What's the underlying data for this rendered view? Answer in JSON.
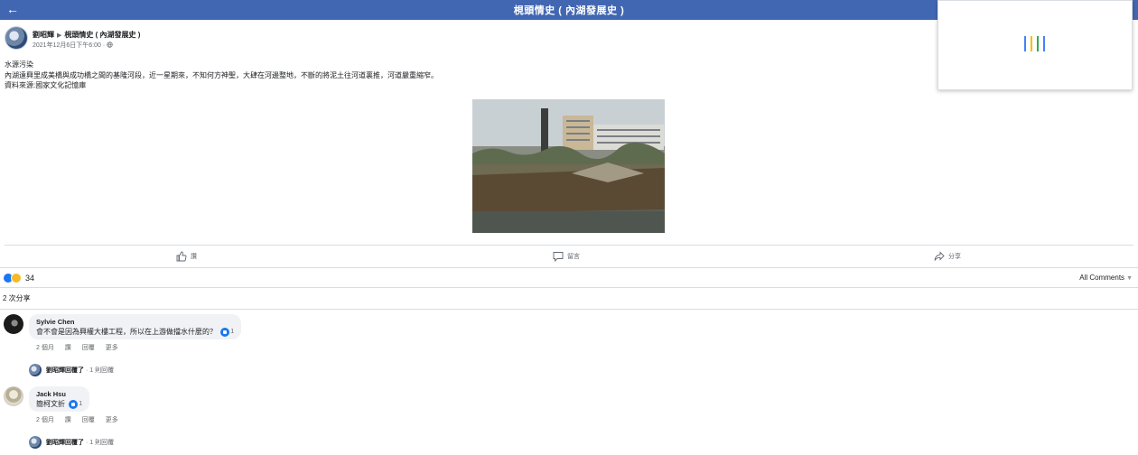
{
  "header": {
    "back_icon": "back-arrow-icon",
    "title": "梘頭情史 ( 內湖發展史 )"
  },
  "popup": {
    "spinner_colors": [
      "#4285f4",
      "#ea4335",
      "#fbbc05",
      "#34a853"
    ]
  },
  "post": {
    "author": "劉昭輝",
    "arrow": "▶",
    "group": "梘頭情史 ( 內湖發展史 )",
    "timestamp": "2021年12月6日下午6:00",
    "privacy_icon": "globe-icon",
    "text_lines": [
      "水源污染",
      "內湖遠興里成美橋與成功橋之間的基隆河段，近一星期來，不知何方神聖，大肆在河邊整地，不斷的將泥土往河道裏推，河道嚴重縮窄。",
      "資料來源:國家文化記憶庫"
    ]
  },
  "actions": {
    "like": "讚",
    "comment": "留言",
    "share": "分享"
  },
  "reactions": {
    "count": "34",
    "all_comments": "All Comments",
    "shares_text": "2 次分享"
  },
  "comments": [
    {
      "name": "Sylvie Chen",
      "text": "會不會是因為興權大樓工程，所以在上游做擋水什麼的？",
      "like_count": "1",
      "time": "2 個月",
      "like": "讚",
      "reply": "回覆",
      "more": "更多",
      "reply_summary_name": "劉昭輝回覆了",
      "reply_summary_count": "· 1 則回覆"
    },
    {
      "name": "Jack Hsu",
      "text": "簡柯文折",
      "like_count": "1",
      "time": "2 個月",
      "like": "讚",
      "reply": "回覆",
      "more": "更多",
      "reply_summary_name": "劉昭輝回覆了",
      "reply_summary_count": "· 1 則回覆"
    }
  ]
}
